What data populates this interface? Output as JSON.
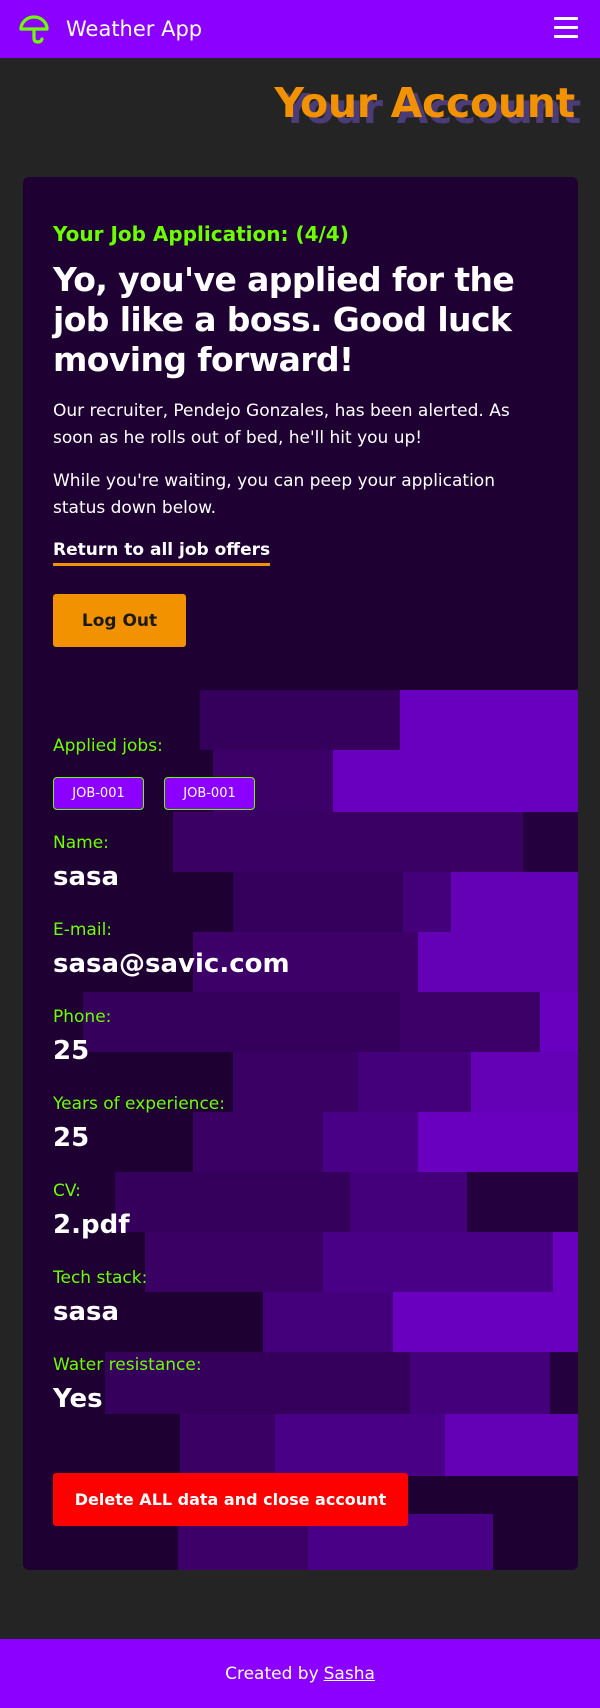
{
  "header": {
    "app_name": "Weather App",
    "logo_icon": "umbrella-icon",
    "menu_icon": "hamburger-menu-icon"
  },
  "page_title": "Your Account",
  "application": {
    "step": "Your Job Application: (4/4)",
    "headline": "Yo, you've applied for the job like a boss. Good luck moving forward!",
    "paragraph_1": "Our recruiter, Pendejo Gonzales, has been alerted. As soon as he rolls out of bed, he'll hit you up!",
    "paragraph_2": "While you're waiting, you can peep your application status down below.",
    "return_link": "Return to all job offers",
    "logout_label": "Log Out"
  },
  "details": {
    "applied_jobs_label": "Applied jobs:",
    "applied_jobs": [
      "JOB-001",
      "JOB-001"
    ],
    "fields": [
      {
        "label": "Name:",
        "value": "sasa"
      },
      {
        "label": "E-mail:",
        "value": "sasa@savic.com"
      },
      {
        "label": "Phone:",
        "value": "25"
      },
      {
        "label": "Years of experience:",
        "value": "25"
      },
      {
        "label": "CV:",
        "value": "2.pdf"
      },
      {
        "label": "Tech stack:",
        "value": "sasa"
      },
      {
        "label": "Water resistance:",
        "value": "Yes"
      }
    ],
    "delete_label": "Delete ALL data and close account"
  },
  "footer": {
    "prefix": "Created by",
    "author_link": "Sasha"
  },
  "colors": {
    "accent_purple": "#8c00ff",
    "accent_orange": "#f39200",
    "label_green": "#6cff00",
    "danger_red": "#ff0000",
    "card_background": "#1f0033",
    "page_background": "#242424"
  }
}
